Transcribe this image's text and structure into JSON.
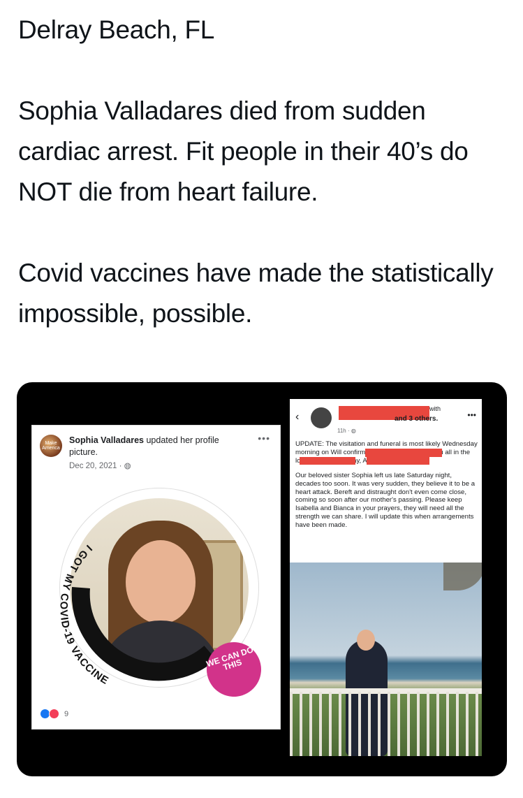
{
  "tweet": {
    "location": "Delray Beach, FL",
    "paragraph1": "Sophia Valladares died from sudden cardiac arrest. Fit people in their 40’s do NOT die from heart failure.",
    "paragraph2": "Covid vaccines have made the statistically impossible, possible."
  },
  "left_post": {
    "avatar_text": "Make America",
    "author": "Sophia Valladares",
    "action": " updated her profile picture.",
    "date": "Dec 20, 2021 · ",
    "ring_text": "I GOT MY COVID-19 VACCINE",
    "badge_text": "WE CAN DO THIS",
    "reaction_count": "9"
  },
  "right_post": {
    "with": "with",
    "others": "and 3 others.",
    "time": "11h · ",
    "paragraph1": "UPDATE: The visitation and funeral is most likely Wednesday morning                              on                              Will confirm exact times and keep you all in the loop.  As of 7pm today, Alexis.",
    "paragraph2": "Our beloved sister Sophia left us late Saturday night, decades too soon.  It was very sudden, they believe it to be a heart attack.  Bereft and distraught don't even come close, coming so soon after our mother's passing.  Please keep Isabella and Bianca in your prayers, they will need all the strength we can share.  I will update this when arrangements have been made."
  },
  "icons": {
    "back": "‹",
    "more": "•••",
    "globe": "◍"
  }
}
